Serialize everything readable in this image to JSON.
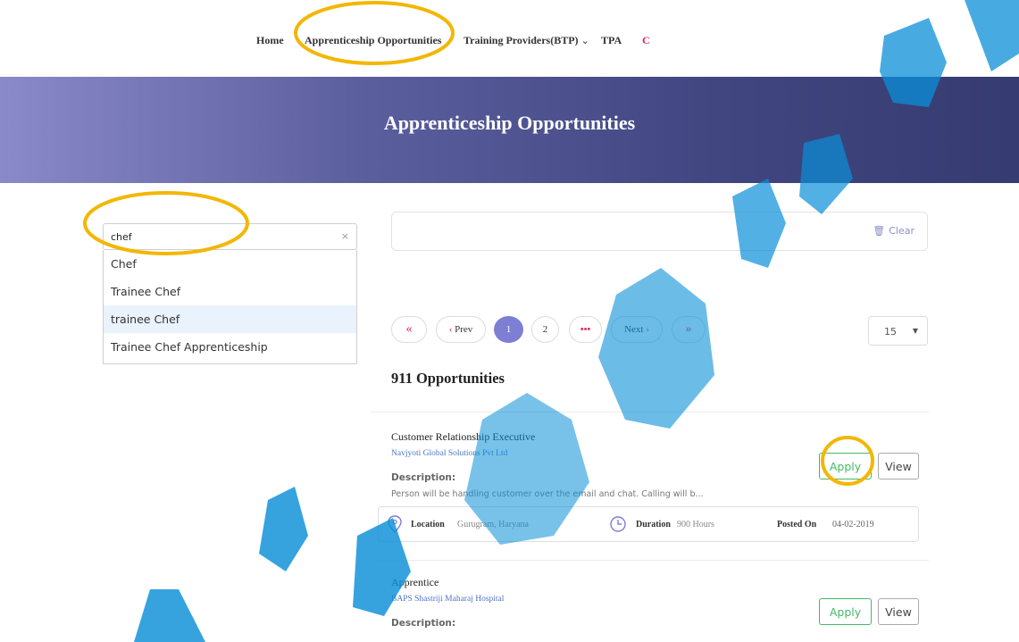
{
  "nav": {
    "home": "Home",
    "opportunities": "Apprenticeship Opportunities",
    "training_providers": "Training Providers(BTP)",
    "tpa": "TPA",
    "more": "C"
  },
  "banner": {
    "title": "Apprenticeship Opportunities"
  },
  "search": {
    "value": "chef",
    "clear_symbol": "×",
    "suggestions": [
      "Chef",
      "Trainee Chef",
      "trainee Chef",
      "Trainee Chef Apprenticeship"
    ],
    "highlighted_index": 2
  },
  "filters": {
    "clear_label": "Clear"
  },
  "pagination": {
    "first": "«",
    "prev": "Prev",
    "pages": [
      "1",
      "2"
    ],
    "current_page": "1",
    "ellipsis": "•••",
    "next": "Next",
    "last": "»",
    "per_page": "15"
  },
  "results": {
    "count_label": "911 Opportunities",
    "jobs": [
      {
        "title": "Customer Relationship Executive",
        "company": "Navjyoti Global Solutions Pvt Ltd",
        "description_label": "Description:",
        "description": "Person will be handling customer over the email and chat. Calling will b...",
        "apply_label": "Apply",
        "view_label": "View",
        "location_label": "Location",
        "location": "Gurugram, Haryana",
        "duration_label": "Duration",
        "duration": "900 Hours",
        "posted_label": "Posted On",
        "posted": "04-02-2019"
      },
      {
        "title": "Apprentice",
        "company": "BAPS Shastriji Maharaj Hospital",
        "description_label": "Description:",
        "apply_label": "Apply",
        "view_label": "View"
      }
    ]
  },
  "colors": {
    "accent": "#7c7fd4",
    "apply_green": "#44b865",
    "annotation": "#f2b705",
    "watermark": "#0a8fd8",
    "banner_start": "#8a89c9",
    "banner_end": "#363b71"
  }
}
